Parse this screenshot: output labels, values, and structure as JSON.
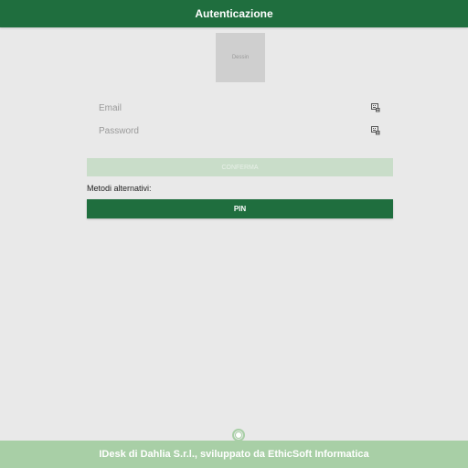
{
  "colors": {
    "brand": "#1f6e3e",
    "footer": "#a8cfa6",
    "confirm_disabled": "#c9ddc9"
  },
  "header": {
    "title": "Autenticazione"
  },
  "logo": {
    "text": "Dessin",
    "icon": "logo-placeholder"
  },
  "form": {
    "email": {
      "placeholder": "Email",
      "value": "",
      "icon": "keyboard-list-icon"
    },
    "password": {
      "placeholder": "Password",
      "value": "",
      "icon": "keyboard-list-icon"
    },
    "confirm_label": "CONFERMA"
  },
  "alternatives": {
    "label": "Metodi alternativi:",
    "pin_label": "PIN"
  },
  "footer": {
    "text": "IDesk di Dahlia S.r.l., sviluppato da EthicSoft Informatica",
    "icon": "circle-handle-icon"
  }
}
